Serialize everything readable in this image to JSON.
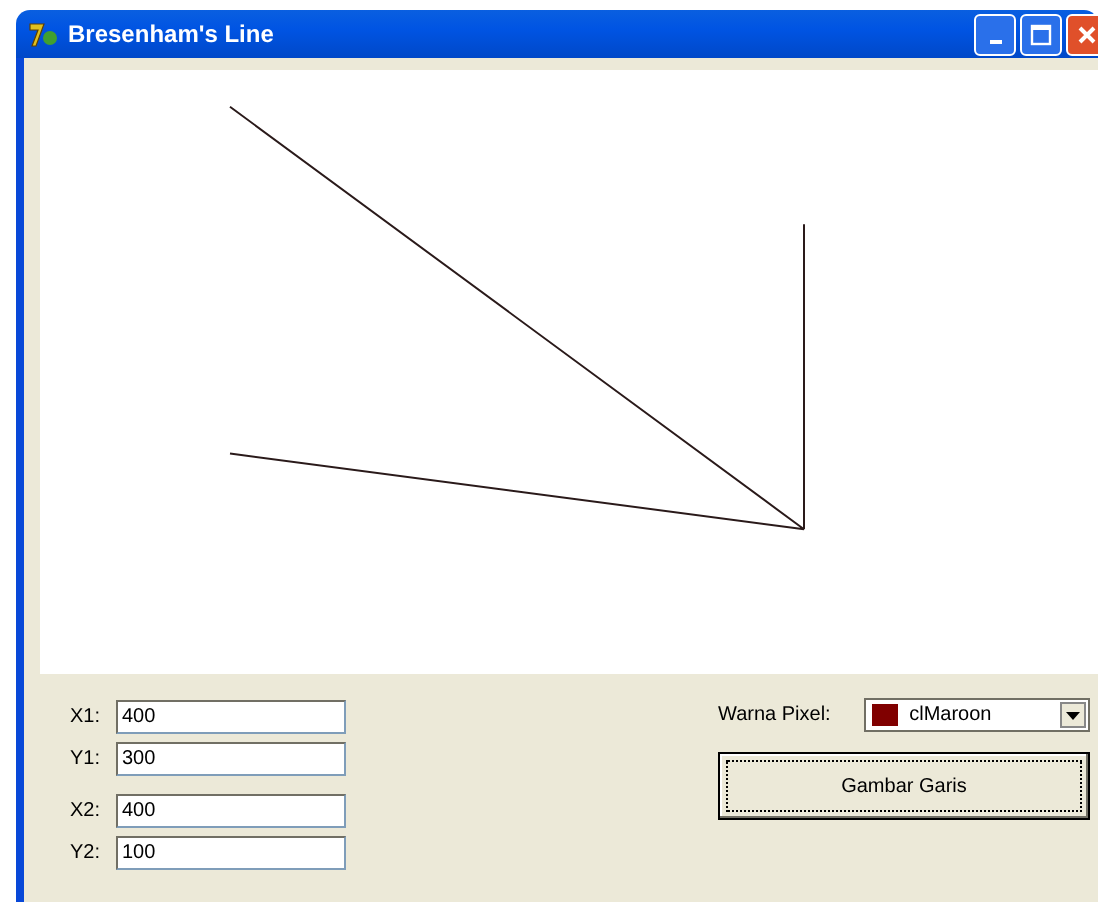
{
  "window": {
    "title": "Bresenham's Line"
  },
  "fields": [
    {
      "label": "X1:",
      "value": "400"
    },
    {
      "label": "Y1:",
      "value": "300"
    },
    {
      "label": "X2:",
      "value": "400"
    },
    {
      "label": "Y2:",
      "value": "100"
    }
  ],
  "pixel_color": {
    "label": "Warna Pixel:",
    "value": "clMaroon",
    "color": "#800000"
  },
  "draw_button": {
    "label": "Gambar Garis"
  }
}
